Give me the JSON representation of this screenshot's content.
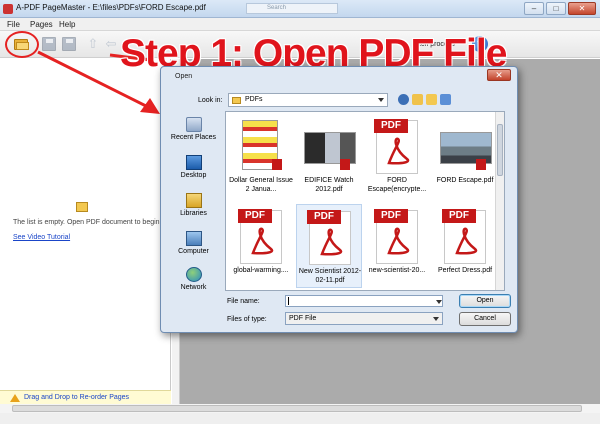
{
  "app": {
    "title": "A-PDF PageMaster - E:\\files\\PDFs\\FORD Escape.pdf",
    "ghost_search": "Search",
    "minimize": "–",
    "maximize": "□",
    "close": "✕"
  },
  "menu": [
    "File",
    "Pages",
    "Help"
  ],
  "toolbar": {
    "batch_label": "tch process",
    "help": "?"
  },
  "banner": "Step 1: Open PDF File",
  "left_panel": {
    "empty_text": "The list is empty. Open PDF document to begin",
    "video_link": "See Video Tutorial",
    "status": "Drag and Drop to Re-order Pages"
  },
  "dialog": {
    "title": "Open",
    "close": "✕",
    "look_in_label": "Look in:",
    "look_in_value": "PDFs",
    "places": [
      "Recent Places",
      "Desktop",
      "Libraries",
      "Computer",
      "Network"
    ],
    "files": [
      {
        "name": "Dollar General Issue 2 Janua...",
        "kind": "img-doc"
      },
      {
        "name": "EDIFICE Watch 2012.pdf",
        "kind": "img-wide"
      },
      {
        "name": "FORD Escape(encrypte...",
        "kind": "pdf"
      },
      {
        "name": "FORD Escape.pdf",
        "kind": "img-car"
      },
      {
        "name": "global-warming....",
        "kind": "pdf"
      },
      {
        "name": "New Scientist 2012-02-11.pdf",
        "kind": "pdf"
      },
      {
        "name": "new-scientist-20...",
        "kind": "pdf"
      },
      {
        "name": "Perfect Dress.pdf",
        "kind": "pdf"
      }
    ],
    "pdf_tag": "PDF",
    "file_name_label": "File name:",
    "file_name_value": "",
    "file_type_label": "Files of type:",
    "file_type_value": "PDF File",
    "open_button": "Open",
    "cancel_button": "Cancel"
  },
  "colors": {
    "accent_red": "#e0141c",
    "pdf_red": "#c41818",
    "link_blue": "#1a45c8"
  }
}
